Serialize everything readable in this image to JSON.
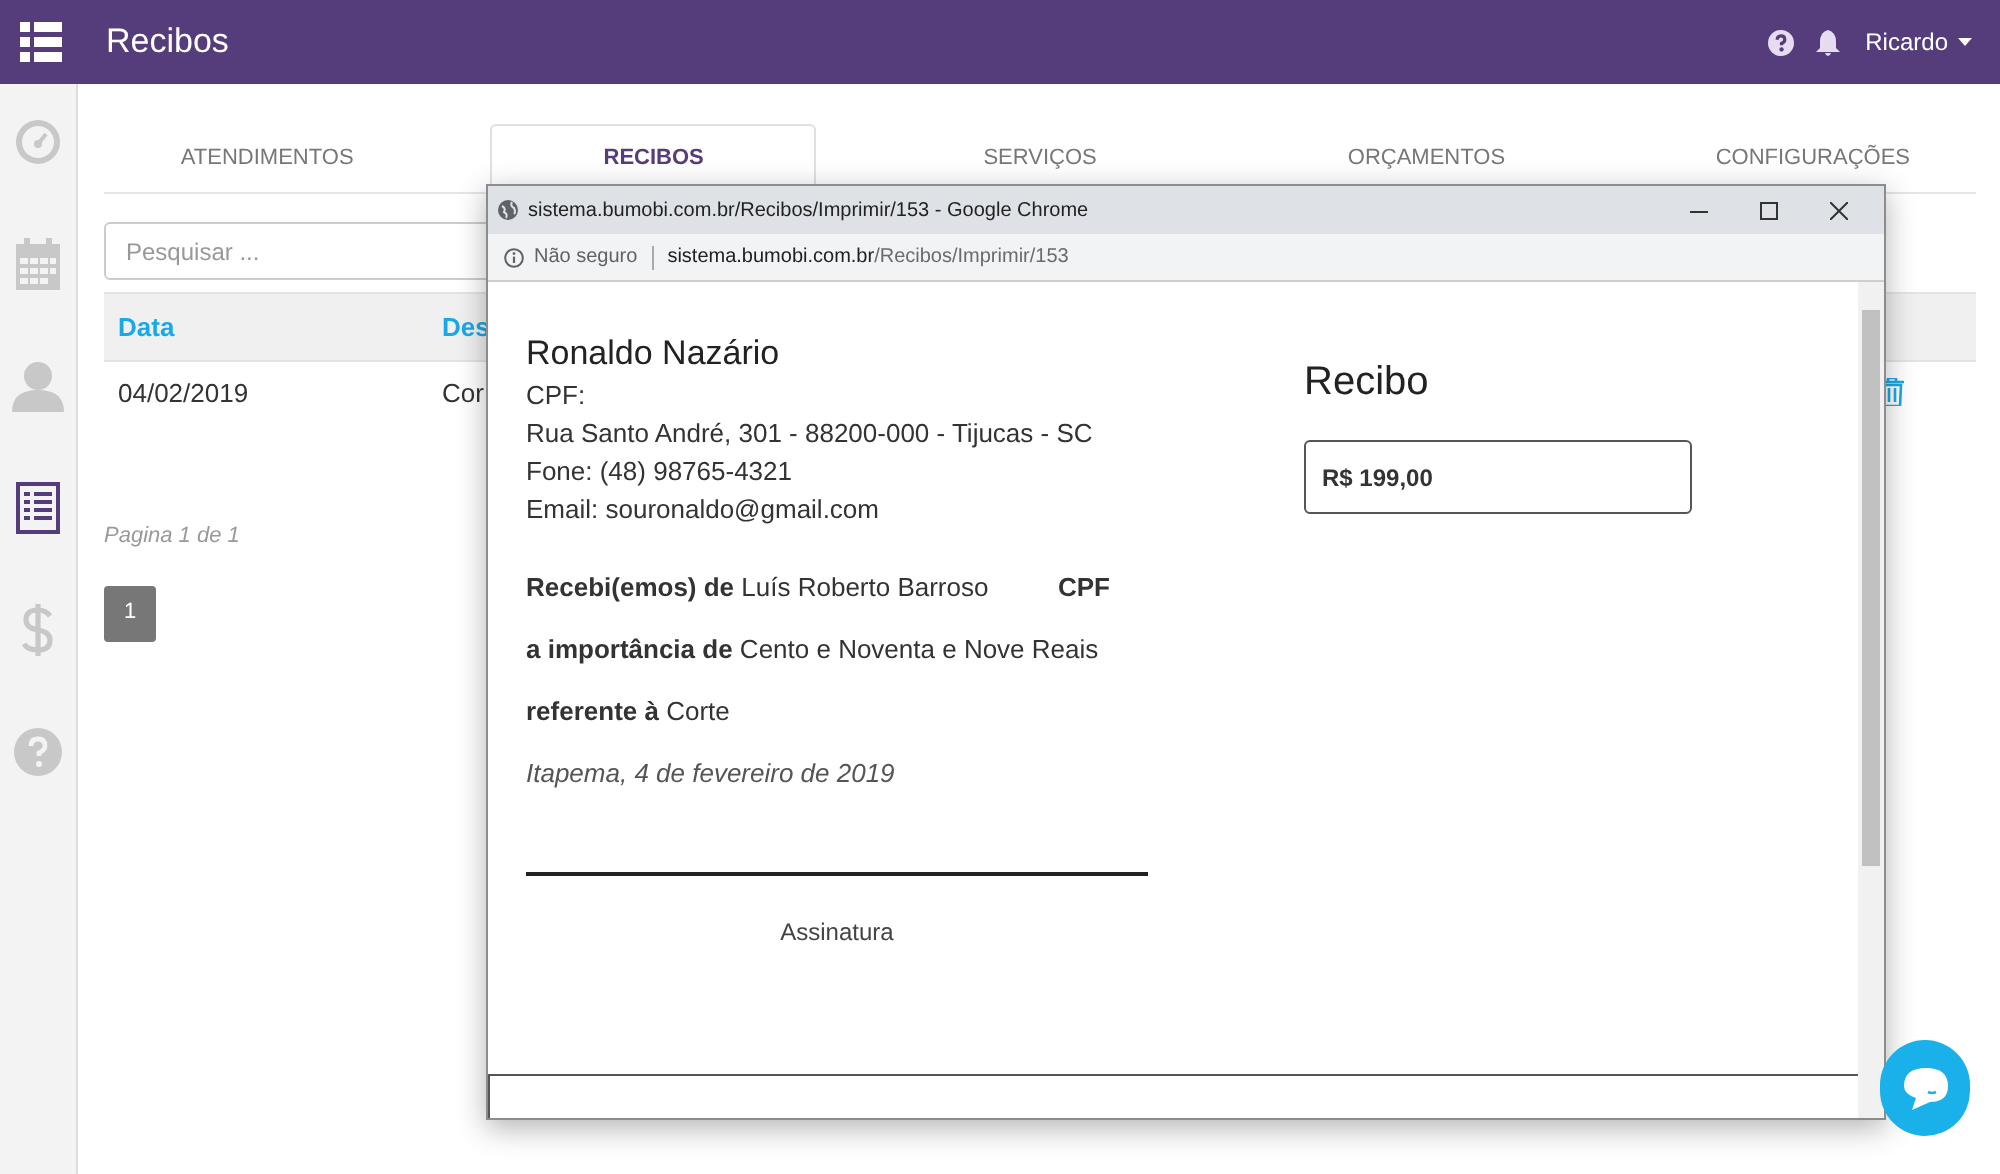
{
  "app_bar": {
    "title": "Recibos",
    "user": "Ricardo"
  },
  "sidebar": {
    "items": [
      {
        "kind": "gauge",
        "selected": false
      },
      {
        "kind": "calendar",
        "selected": false
      },
      {
        "kind": "person",
        "selected": false
      },
      {
        "kind": "list",
        "selected": true
      },
      {
        "kind": "dollar",
        "selected": false
      },
      {
        "kind": "help",
        "selected": false
      }
    ]
  },
  "tabs": [
    {
      "label": "ATENDIMENTOS",
      "selected": false
    },
    {
      "label": "RECIBOS",
      "selected": true
    },
    {
      "label": "SERVIÇOS",
      "selected": false
    },
    {
      "label": "ORÇAMENTOS",
      "selected": false
    },
    {
      "label": "CONFIGURAÇÕES",
      "selected": false
    }
  ],
  "search": {
    "placeholder": "Pesquisar ..."
  },
  "table": {
    "columns": [
      "Data",
      "Des"
    ],
    "rows": [
      [
        "04/02/2019",
        "Cor"
      ]
    ]
  },
  "pagination": {
    "summary": "Pagina 1 de 1",
    "pages": [
      {
        "label": "1",
        "selected": true
      }
    ]
  },
  "popup": {
    "title": "sistema.bumobi.com.br/Recibos/Imprimir/153 - Google Chrome",
    "security": "Não seguro",
    "url_host": "sistema.bumobi.com.br",
    "url_path": "/Recibos/Imprimir/153",
    "receipt": {
      "issuer_name": "Ronaldo Nazário",
      "issuer_lines": [
        "CPF:",
        "Rua Santo André, 301 - 88200-000 - Tijucas - SC",
        "Fone: (48) 98765-4321",
        "Email: souronaldo@gmail.com"
      ],
      "heading": "Recibo",
      "amount": "R$ 199,00",
      "statements": [
        {
          "text": "**Recebi(emos) de** Luís Roberto Barroso",
          "extra": "CPF"
        },
        {
          "text": "**a importância de** Cento e Noventa e Nove Reais"
        },
        {
          "text": "**referente à** Corte"
        }
      ],
      "date": "Itapema, 4 de fevereiro de 2019",
      "signature_label": "Assinatura"
    }
  }
}
